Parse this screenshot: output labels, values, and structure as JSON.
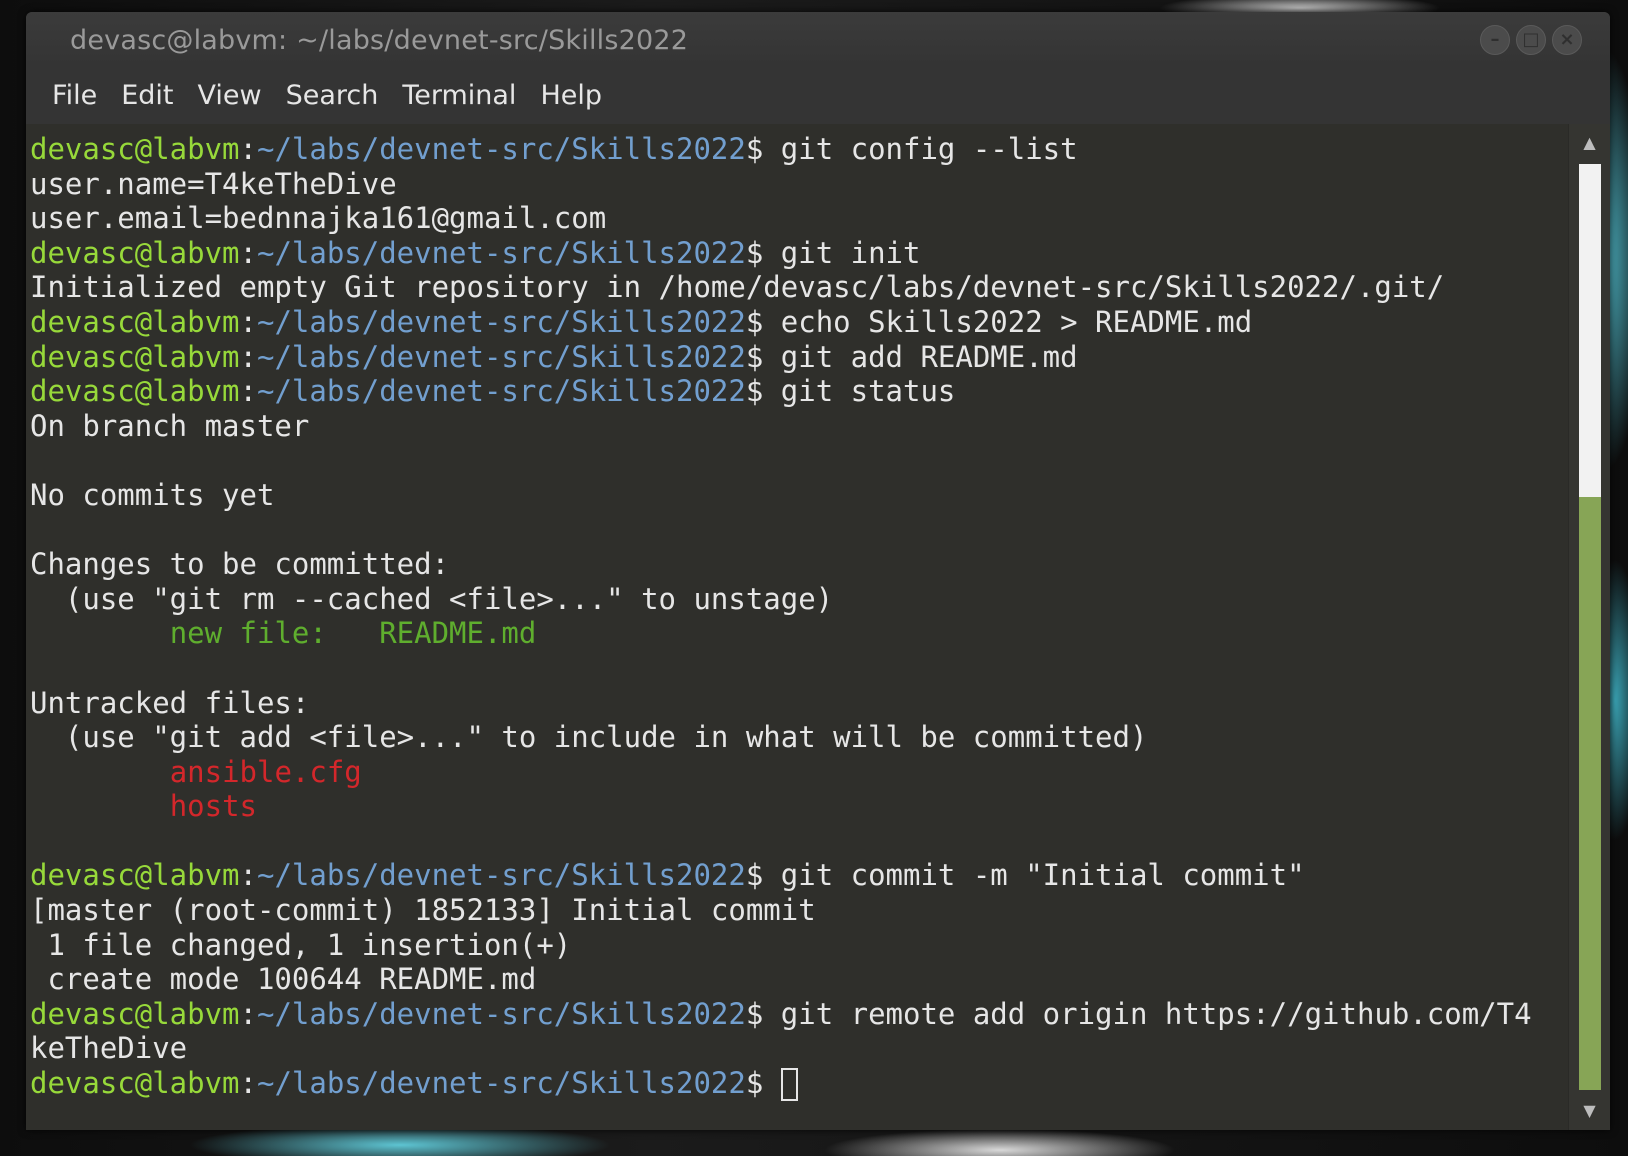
{
  "window": {
    "title": "devasc@labvm: ~/labs/devnet-src/Skills2022",
    "controls": {
      "minimize": "–",
      "maximize": "□",
      "close": "×"
    }
  },
  "menu": [
    "File",
    "Edit",
    "View",
    "Search",
    "Terminal",
    "Help"
  ],
  "prompt": {
    "user": "devasc@labvm",
    "colon": ":",
    "path": "~/labs/devnet-src/Skills2022",
    "dollar": "$ "
  },
  "lines": [
    {
      "cmd": "git config --list"
    },
    {
      "text": "user.name=T4keTheDive"
    },
    {
      "text": "user.email=bednnajka161@gmail.com"
    },
    {
      "cmd": "git init"
    },
    {
      "text": "Initialized empty Git repository in /home/devasc/labs/devnet-src/Skills2022/.git/"
    },
    {
      "cmd": "echo Skills2022 > README.md"
    },
    {
      "cmd": "git add README.md"
    },
    {
      "cmd": "git status"
    },
    {
      "text": "On branch master"
    },
    {
      "text": ""
    },
    {
      "text": "No commits yet"
    },
    {
      "text": ""
    },
    {
      "text": "Changes to be committed:"
    },
    {
      "text": "  (use \"git rm --cached <file>...\" to unstage)"
    },
    {
      "text": "\tnew file:   README.md",
      "color": "green"
    },
    {
      "text": ""
    },
    {
      "text": "Untracked files:"
    },
    {
      "text": "  (use \"git add <file>...\" to include in what will be committed)"
    },
    {
      "text": "\tansible.cfg",
      "color": "red"
    },
    {
      "text": "\thosts",
      "color": "red"
    },
    {
      "text": ""
    },
    {
      "cmd": "git commit -m \"Initial commit\""
    },
    {
      "text": "[master (root-commit) 1852133] Initial commit"
    },
    {
      "text": " 1 file changed, 1 insertion(+)"
    },
    {
      "text": " create mode 100644 README.md"
    },
    {
      "cmd": "git remote add origin https://github.com/T4"
    },
    {
      "text": "keTheDive"
    },
    {
      "cmd": "",
      "cursor": true
    }
  ],
  "colors": {
    "background": "#2f2f2b",
    "prompt_user": "#97d93a",
    "prompt_path": "#729fcf",
    "staged": "#5fae2e",
    "untracked": "#d3272b",
    "scroll_thumb": "#87a556"
  },
  "scroll_position": 0.64
}
